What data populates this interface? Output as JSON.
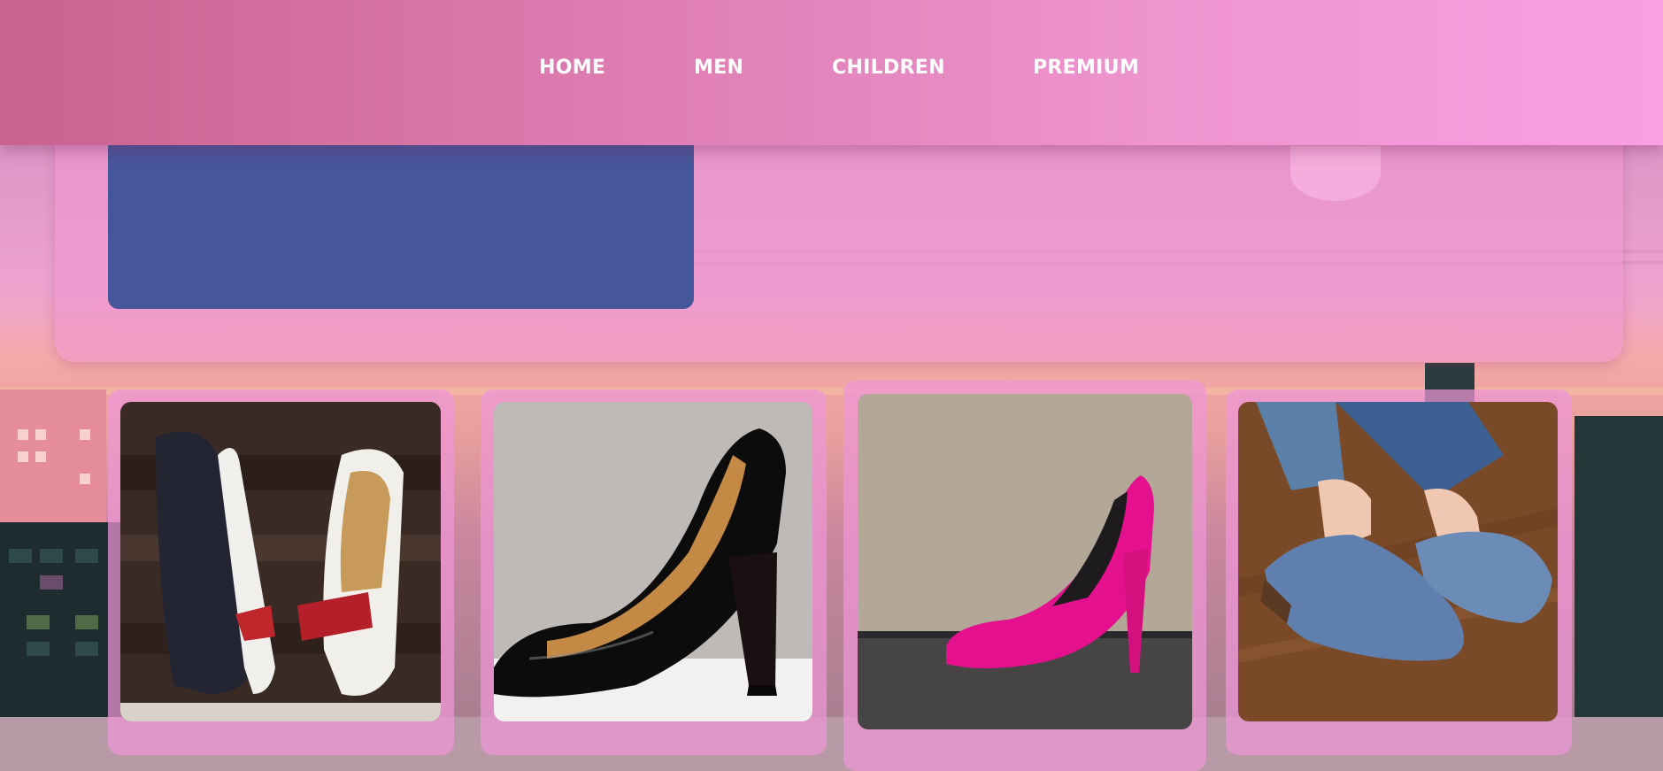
{
  "nav": {
    "items": [
      {
        "label": "HOME"
      },
      {
        "label": "MEN"
      },
      {
        "label": "CHILDREN"
      },
      {
        "label": "PREMIUM"
      }
    ]
  },
  "products": [
    {
      "image": "white-navy-flats-with-red-embroidery"
    },
    {
      "image": "black-patent-block-heel-pump"
    },
    {
      "image": "magenta-stiletto-pump"
    },
    {
      "image": "blue-glitter-flats-on-feet"
    }
  ],
  "colors": {
    "header_start": "#c9628f",
    "header_end": "#fa9fe4",
    "hero_block": "#46569a",
    "card_bg": "#ee96d7"
  }
}
